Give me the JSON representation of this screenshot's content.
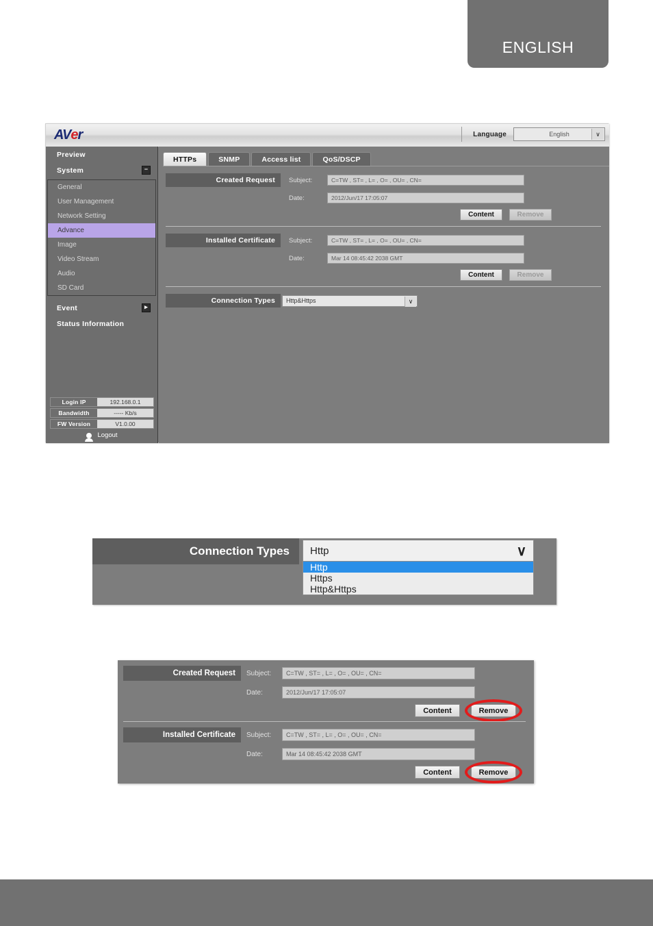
{
  "header": {
    "language_tab": "ENGLISH"
  },
  "figure_main": {
    "logo": {
      "part1": "AV",
      "part2": "e",
      "part3": "r"
    },
    "language": {
      "label": "Language",
      "value": "English",
      "arrow": "∨"
    },
    "sidebar": {
      "top_items": [
        {
          "label": "Preview",
          "toggle": ""
        },
        {
          "label": "System",
          "toggle": "−"
        }
      ],
      "sub_items": [
        {
          "label": "General",
          "active": false
        },
        {
          "label": "User Management",
          "active": false
        },
        {
          "label": "Network Setting",
          "active": false
        },
        {
          "label": "Advance",
          "active": true
        },
        {
          "label": "Image",
          "active": false
        },
        {
          "label": "Video Stream",
          "active": false
        },
        {
          "label": "Audio",
          "active": false
        },
        {
          "label": "SD Card",
          "active": false
        }
      ],
      "bottom_items": [
        {
          "label": "Event",
          "toggle": "▸"
        },
        {
          "label": "Status Information",
          "toggle": ""
        }
      ],
      "status": [
        {
          "key": "Login IP",
          "value": "192.168.0.1"
        },
        {
          "key": "Bandwidth",
          "value": "----- Kb/s"
        },
        {
          "key": "FW Version",
          "value": "V1.0.00"
        }
      ],
      "logout": "Logout"
    },
    "tabs": [
      {
        "label": "HTTPs",
        "active": true
      },
      {
        "label": "SNMP",
        "active": false
      },
      {
        "label": "Access list",
        "active": false
      },
      {
        "label": "QoS/DSCP",
        "active": false
      }
    ],
    "created_request": {
      "title": "Created Request",
      "subject_label": "Subject:",
      "subject_value": "C=TW , ST= , L= , O= , OU= , CN=",
      "date_label": "Date:",
      "date_value": "2012/Jun/17 17:05:07",
      "content_button": "Content",
      "remove_button": "Remove"
    },
    "installed_certificate": {
      "title": "Installed Certificate",
      "subject_label": "Subject:",
      "subject_value": "C=TW , ST= , L= , O= , OU= , CN=",
      "date_label": "Date:",
      "date_value": "Mar 14 08:45:42 2038 GMT",
      "content_button": "Content",
      "remove_button": "Remove"
    },
    "connection_types": {
      "title": "Connection Types",
      "value": "Http&Https",
      "arrow": "∨"
    }
  },
  "figure_dropdown": {
    "title": "Connection Types",
    "selected_value": "Http",
    "arrow": "∨",
    "options": [
      {
        "label": "Http",
        "selected": true
      },
      {
        "label": "Https",
        "selected": false
      },
      {
        "label": "Http&Https",
        "selected": false
      }
    ]
  },
  "figure_remove": {
    "created_request": {
      "title": "Created Request",
      "subject_label": "Subject:",
      "subject_value": "C=TW , ST= , L= , O= , OU= , CN=",
      "date_label": "Date:",
      "date_value": "2012/Jun/17 17:05:07",
      "content_button": "Content",
      "remove_button": "Remove"
    },
    "installed_certificate": {
      "title": "Installed Certificate",
      "subject_label": "Subject:",
      "subject_value": "C=TW , ST= , L= , O= , OU= , CN=",
      "date_label": "Date:",
      "date_value": "Mar 14 08:45:42 2038 GMT",
      "content_button": "Content",
      "remove_button": "Remove"
    }
  },
  "colors": {
    "accent_highlight": "#b9a5e8",
    "annotation_red": "#e21b1b",
    "dropdown_selected": "#2a8fe8",
    "panel_gray": "#7d7d7d",
    "chrome_gray": "#717171"
  }
}
